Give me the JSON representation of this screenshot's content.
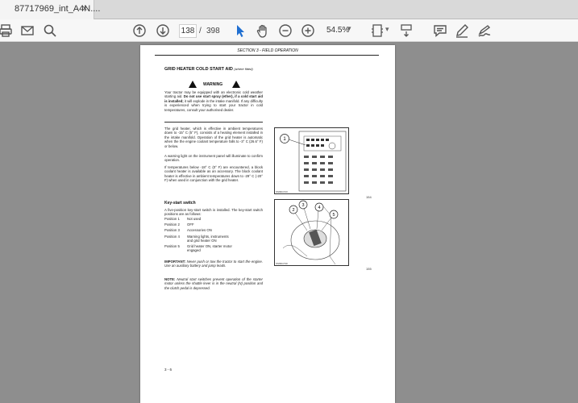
{
  "tab": {
    "title": "87717969_int_A4N....",
    "close": "×"
  },
  "toolbar": {
    "icons": [
      "printer-icon",
      "mail-icon",
      "search-icon",
      "page-up-icon",
      "page-down-icon",
      "select-cursor-icon",
      "hand-pan-icon",
      "zoom-out-icon",
      "zoom-in-icon",
      "fit-page-icon",
      "scroll-mode-icon",
      "comment-icon",
      "pen-icon",
      "sign-icon"
    ],
    "current_page": "138",
    "separator": "/",
    "total_pages": "398",
    "zoom": "54.5%"
  },
  "document": {
    "header": "SECTION 3 - FIELD OPERATION",
    "title": "GRID HEATER COLD START AID",
    "title_note": "(where fitted)",
    "warning_label": "WARNING",
    "warning_text_before": "Your tractor may be equipped with an electronic cold weather starting aid. ",
    "warning_text_bold": "Do not use start spray (ether), if a cold start aid is installed;",
    "warning_text_after": " it will explode in the intake manifold. If any difficulty is experienced when trying to start your tractor in cold temperatures, consult your authorised dealer.",
    "para1": "The grid heater, which is effective in ambient temperatures down to -15° C (5° F), consists of a heating element installed in the intake manifold. Operation of the grid heater is automatic when the the engine coolant temperature falls to -3° C (26.6° F) or below.",
    "para2": "A warning light on the instrument panel will illuminate to confirm operation.",
    "para3": "If temperatures below -18° C (0° F) are encountered, a block coolant heater is available as an accessory. The block coolant heater is effective in ambient temperatures down to -29° C (-20° F) when used in conjunction with the grid heater.",
    "section2_title": "Key-start switch",
    "section2_intro": "A five-position key-start switch is installed. The key-start switch positions are as follows:",
    "positions": [
      {
        "key": "Position 1",
        "value": "Not used"
      },
      {
        "key": "Position 2",
        "value": "OFF"
      },
      {
        "key": "Position 3",
        "value": "Accessories ON"
      },
      {
        "key": "Position 4",
        "value": "Warning lights, instruments\nand grid heater ON"
      },
      {
        "key": "Position 5",
        "value": "Grid heater ON, starter motor\nengaged"
      }
    ],
    "important_label": "IMPORTANT:",
    "important_text": " Never push or tow the tractor to start the engine. Use an auxiliary battery and jump leads.",
    "note_label": "NOTE:",
    "note_text": " Neutral start switches prevent operation of the starter motor unless the shuttle lever is in the neutral (N) position and the clutch pedal is depressed.",
    "figure1": {
      "number": "154",
      "code": "SS99G723",
      "callout": "1"
    },
    "figure2": {
      "number": "155",
      "code": "SS99G730",
      "callouts": [
        "2",
        "3",
        "4",
        "5"
      ]
    },
    "page_number": "3 - 6"
  }
}
